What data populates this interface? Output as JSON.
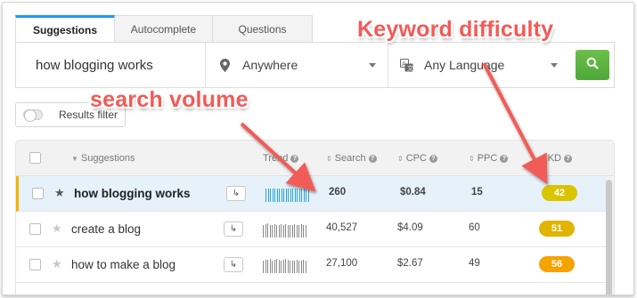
{
  "tabs": [
    {
      "label": "Suggestions",
      "active": true
    },
    {
      "label": "Autocomplete",
      "active": false
    },
    {
      "label": "Questions",
      "active": false
    }
  ],
  "search": {
    "keyword_value": "how blogging works",
    "location": "Anywhere",
    "location_icon": "map-pin-icon",
    "language": "Any Language",
    "language_icon": "translate-icon",
    "submit_icon": "search-icon",
    "submit_color": "#5cb85c"
  },
  "filter": {
    "label": "Results filter",
    "enabled": false
  },
  "table": {
    "columns": {
      "suggestions": "Suggestions",
      "trend": "Trend",
      "search": "Search",
      "cpc": "CPC",
      "ppc": "PPC",
      "kd": "KD"
    },
    "rows": [
      {
        "keyword": "how blogging works",
        "highlighted": true,
        "starred": true,
        "trend": [
          0.9,
          0.9,
          0.9,
          0.9,
          0.9,
          0.9,
          0.9,
          0.9,
          0.9,
          0.9,
          0.9,
          0.9,
          0.9,
          0.9,
          0.9,
          0.9,
          0.9,
          0.9,
          0.9,
          0.9
        ],
        "search": "260",
        "cpc": "$0.84",
        "ppc": "15",
        "kd": "42",
        "kd_color": "#d9c400"
      },
      {
        "keyword": "create a blog",
        "highlighted": false,
        "starred": false,
        "trend": [
          0.85,
          0.9,
          0.95,
          0.85,
          0.8,
          0.9,
          0.85,
          0.8,
          0.9,
          0.85,
          0.9,
          0.85,
          0.8,
          0.85,
          0.9,
          0.85,
          0.8,
          0.9,
          0.85,
          0.8
        ],
        "search": "40,527",
        "cpc": "$4.09",
        "ppc": "60",
        "kd": "51",
        "kd_color": "#e0b400"
      },
      {
        "keyword": "how to make a blog",
        "highlighted": false,
        "starred": false,
        "trend": [
          0.85,
          0.9,
          0.9,
          0.95,
          0.85,
          0.9,
          0.95,
          0.9,
          0.85,
          0.9,
          0.95,
          0.9,
          0.85,
          0.8,
          0.85,
          0.9,
          0.85,
          0.85,
          0.9,
          0.85
        ],
        "search": "27,100",
        "cpc": "$2.67",
        "ppc": "49",
        "kd": "56",
        "kd_color": "#f5a300"
      }
    ]
  },
  "annotations": {
    "kd": "Keyword difficulty",
    "volume": "search volume",
    "color": "#f25b57"
  }
}
